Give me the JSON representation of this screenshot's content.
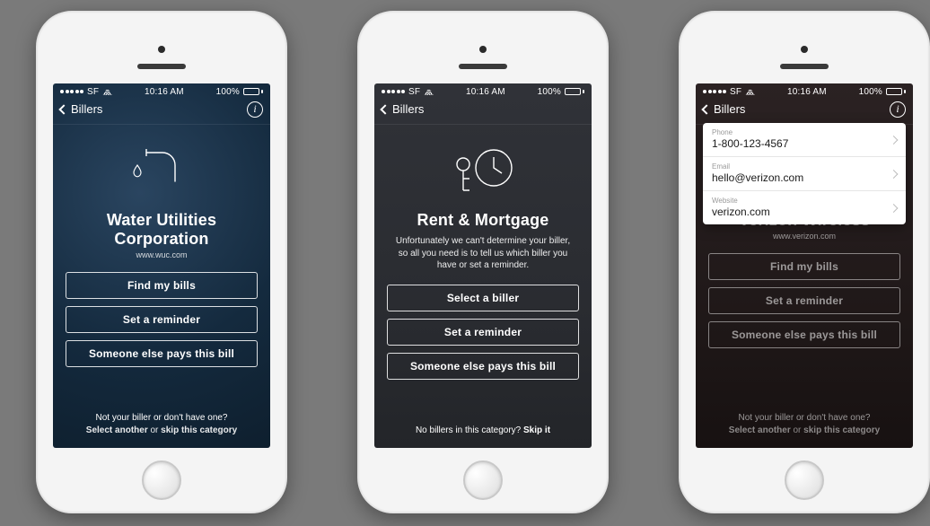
{
  "statusbar": {
    "carrier": "SF",
    "time": "10:16 AM",
    "battery": "100%"
  },
  "nav": {
    "back": "Billers"
  },
  "screens": [
    {
      "id": "water",
      "title": "Water Utilities Corporation",
      "site": "www.wuc.com",
      "buttons": [
        "Find my bills",
        "Set a reminder",
        "Someone else pays this bill"
      ],
      "footer": {
        "line1": "Not your biller or don't have one?",
        "select": "Select another",
        "or": " or ",
        "skip": "skip this category"
      }
    },
    {
      "id": "rent",
      "title": "Rent & Mortgage",
      "desc": "Unfortunately we can't determine your biller, so all you need is to tell us which biller you have or set a reminder.",
      "buttons": [
        "Select a biller",
        "Set a reminder",
        "Someone else pays this bill"
      ],
      "footer": {
        "line": "No billers in this category? ",
        "skip": "Skip it"
      }
    },
    {
      "id": "verizon",
      "title": "Verizon Wireless",
      "site": "www.verizon.com",
      "buttons": [
        "Find my bills",
        "Set a reminder",
        "Someone else pays this bill"
      ],
      "footer": {
        "line1": "Not your biller or don't have one?",
        "select": "Select another",
        "or": " or ",
        "skip": "skip this category"
      },
      "info_panel": [
        {
          "label": "Phone",
          "value": "1-800-123-4567"
        },
        {
          "label": "Email",
          "value": "hello@verizon.com"
        },
        {
          "label": "Website",
          "value": "verizon.com"
        }
      ]
    }
  ]
}
